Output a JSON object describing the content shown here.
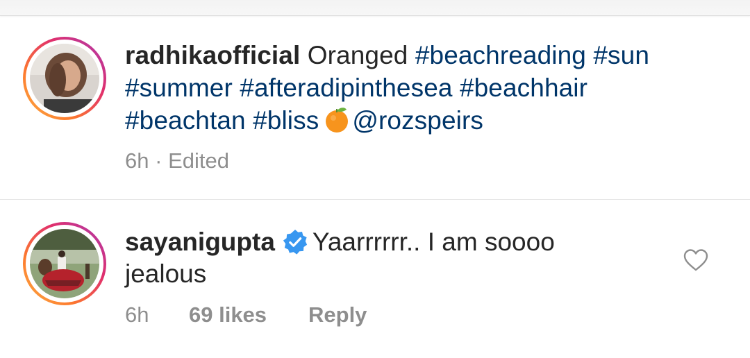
{
  "post": {
    "username": "radhikaofficial",
    "text": "Oranged",
    "hashtags": [
      "#beachreading",
      "#sun",
      "#summer",
      "#afteradipinthesea",
      "#beachhair",
      "#beachtan",
      "#bliss"
    ],
    "emoji": "tangerine-emoji",
    "mention": "@rozspeirs",
    "time": "6h",
    "separator": "·",
    "edited_label": "Edited"
  },
  "comment": {
    "username": "sayanigupta",
    "verified": true,
    "text_line1": "Yaarrrrrr.. I am soooo",
    "text_line2": "jealous",
    "time": "6h",
    "likes_label": "69 likes",
    "reply_label": "Reply"
  },
  "icons": {
    "like": "heart-outline-icon",
    "verified": "verified-badge-icon"
  },
  "colors": {
    "text": "#262626",
    "hashtag": "#003569",
    "meta": "#8e8e8e",
    "verified": "#3897f0",
    "story_ring_start": "#fcb045",
    "story_ring_end": "#a93ab2"
  }
}
